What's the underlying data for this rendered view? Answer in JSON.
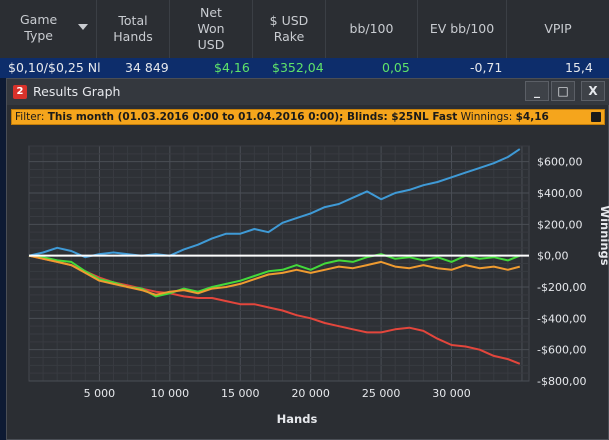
{
  "table": {
    "columns": [
      {
        "label": "Game\nType"
      },
      {
        "label": "Total\nHands"
      },
      {
        "label": "Net\nWon\nUSD"
      },
      {
        "label": "$ USD\nRake"
      },
      {
        "label": "bb/100"
      },
      {
        "label": "EV bb/100"
      },
      {
        "label": "VPIP"
      }
    ],
    "row": {
      "game_type": "$0,10/$0,25 Nl",
      "total_hands": "34 849",
      "net_won": "$4,16",
      "rake": "$352,04",
      "bb100": "0,05",
      "ev_bb100": "-0,71",
      "vpip": "15,4"
    }
  },
  "window": {
    "icon_text": "2",
    "title": "Results Graph",
    "buttons": {
      "minimize": "_",
      "restore": "□",
      "close": "X"
    },
    "filter": {
      "prefix": "Filter: ",
      "text": "This month (01.03.2016 0:00 to 01.04.2016 0:00); Blinds: $25NL Fast",
      "winnings_label": " Winnings: ",
      "winnings_value": "$4,16"
    }
  },
  "chart_data": {
    "type": "line",
    "xlabel": "Hands",
    "ylabel": "Winnings",
    "xlim": [
      0,
      35500
    ],
    "ylim": [
      -800,
      700
    ],
    "x_ticks": [
      5000,
      10000,
      15000,
      20000,
      25000,
      30000
    ],
    "x_tick_labels": [
      "5 000",
      "10 000",
      "15 000",
      "20 000",
      "25 000",
      "30 000"
    ],
    "y_ticks": [
      600,
      400,
      200,
      0,
      -200,
      -400,
      -600,
      -800
    ],
    "y_tick_labels": [
      "$600,00",
      "$400,00",
      "$200,00",
      "$0,00",
      "-$200,00",
      "-$400,00",
      "-$600,00",
      "-$800,00"
    ],
    "grid": true,
    "zero_line_color": "#ffffff",
    "x": [
      0,
      1000,
      2000,
      3000,
      4000,
      5000,
      6000,
      7000,
      8000,
      9000,
      10000,
      11000,
      12000,
      13000,
      14000,
      15000,
      16000,
      17000,
      18000,
      19000,
      20000,
      21000,
      22000,
      23000,
      24000,
      25000,
      26000,
      27000,
      28000,
      29000,
      30000,
      31000,
      32000,
      33000,
      34000,
      34849
    ],
    "series": [
      {
        "color": "#3f9ad6",
        "values": [
          0,
          20,
          50,
          30,
          -10,
          10,
          20,
          10,
          0,
          10,
          0,
          40,
          70,
          110,
          140,
          140,
          170,
          150,
          210,
          240,
          270,
          310,
          330,
          370,
          410,
          360,
          400,
          420,
          450,
          470,
          500,
          530,
          560,
          590,
          630,
          680
        ]
      },
      {
        "color": "#e3463c",
        "values": [
          0,
          -20,
          -40,
          -60,
          -100,
          -140,
          -170,
          -190,
          -210,
          -230,
          -240,
          -260,
          -270,
          -270,
          -290,
          -310,
          -310,
          -330,
          -350,
          -380,
          -400,
          -430,
          -450,
          -470,
          -490,
          -490,
          -470,
          -460,
          -480,
          -530,
          -570,
          -580,
          -600,
          -640,
          -660,
          -690
        ]
      },
      {
        "color": "#43d93a",
        "values": [
          0,
          -10,
          -30,
          -40,
          -100,
          -150,
          -170,
          -200,
          -210,
          -260,
          -240,
          -210,
          -230,
          -200,
          -180,
          -160,
          -130,
          -100,
          -90,
          -60,
          -90,
          -50,
          -30,
          -40,
          -10,
          10,
          -20,
          -10,
          -30,
          -10,
          -40,
          0,
          -20,
          -10,
          -30,
          0
        ]
      },
      {
        "color": "#ef9b30",
        "values": [
          0,
          -20,
          -40,
          -60,
          -110,
          -160,
          -180,
          -200,
          -220,
          -250,
          -230,
          -220,
          -240,
          -210,
          -200,
          -180,
          -150,
          -120,
          -110,
          -90,
          -110,
          -90,
          -70,
          -80,
          -60,
          -40,
          -70,
          -80,
          -60,
          -80,
          -90,
          -60,
          -80,
          -70,
          -90,
          -70
        ]
      }
    ]
  }
}
